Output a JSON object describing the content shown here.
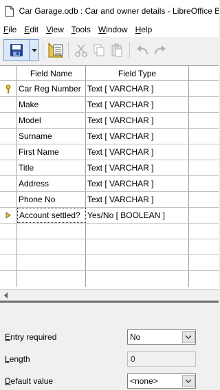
{
  "window": {
    "title": "Car Garage.odb : Car and owner details - LibreOffice Ba"
  },
  "menubar": [
    {
      "label": "File",
      "mnemonic": "F",
      "rest": "ile"
    },
    {
      "label": "Edit",
      "mnemonic": "E",
      "rest": "dit"
    },
    {
      "label": "View",
      "mnemonic": "V",
      "rest": "iew"
    },
    {
      "label": "Tools",
      "mnemonic": "T",
      "rest": "ools"
    },
    {
      "label": "Window",
      "mnemonic": "W",
      "rest": "indow"
    },
    {
      "label": "Help",
      "mnemonic": "H",
      "rest": "elp"
    }
  ],
  "toolbar": {
    "icons": [
      "save-icon",
      "dropdown-arrow-icon",
      "index-design-icon",
      "cut-icon",
      "copy-icon",
      "paste-icon",
      "undo-icon",
      "redo-icon"
    ]
  },
  "grid": {
    "headers": [
      "Field Name",
      "Field Type"
    ],
    "rows": [
      {
        "field_name": "Car Reg Number",
        "field_type": "Text [ VARCHAR ]",
        "marker": "primary-key"
      },
      {
        "field_name": "Make",
        "field_type": "Text [ VARCHAR ]",
        "marker": ""
      },
      {
        "field_name": "Model",
        "field_type": "Text [ VARCHAR ]",
        "marker": ""
      },
      {
        "field_name": "Surname",
        "field_type": "Text [ VARCHAR ]",
        "marker": ""
      },
      {
        "field_name": "First Name",
        "field_type": "Text [ VARCHAR ]",
        "marker": ""
      },
      {
        "field_name": "Title",
        "field_type": "Text [ VARCHAR ]",
        "marker": ""
      },
      {
        "field_name": "Address",
        "field_type": "Text [ VARCHAR ]",
        "marker": ""
      },
      {
        "field_name": "Phone No",
        "field_type": "Text [ VARCHAR ]",
        "marker": ""
      },
      {
        "field_name": "Account settled?",
        "field_type": "Yes/No [ BOOLEAN ]",
        "marker": "current-row"
      }
    ],
    "empty_rows": 4
  },
  "properties": {
    "entry_required": {
      "label": "Entry required",
      "mnemonic": "E",
      "rest": "ntry required",
      "value": "No"
    },
    "length": {
      "label": "Length",
      "mnemonic": "L",
      "rest": "ength",
      "value": "0"
    },
    "default_value": {
      "label": "Default value",
      "mnemonic": "D",
      "rest": "efault value",
      "value": "<none>"
    }
  },
  "colors": {
    "key_icon": "#d9a400",
    "current_row_arrow": "#e8c800",
    "save_icon": "#1f3f8f",
    "splitter": "#6d6d6d"
  }
}
